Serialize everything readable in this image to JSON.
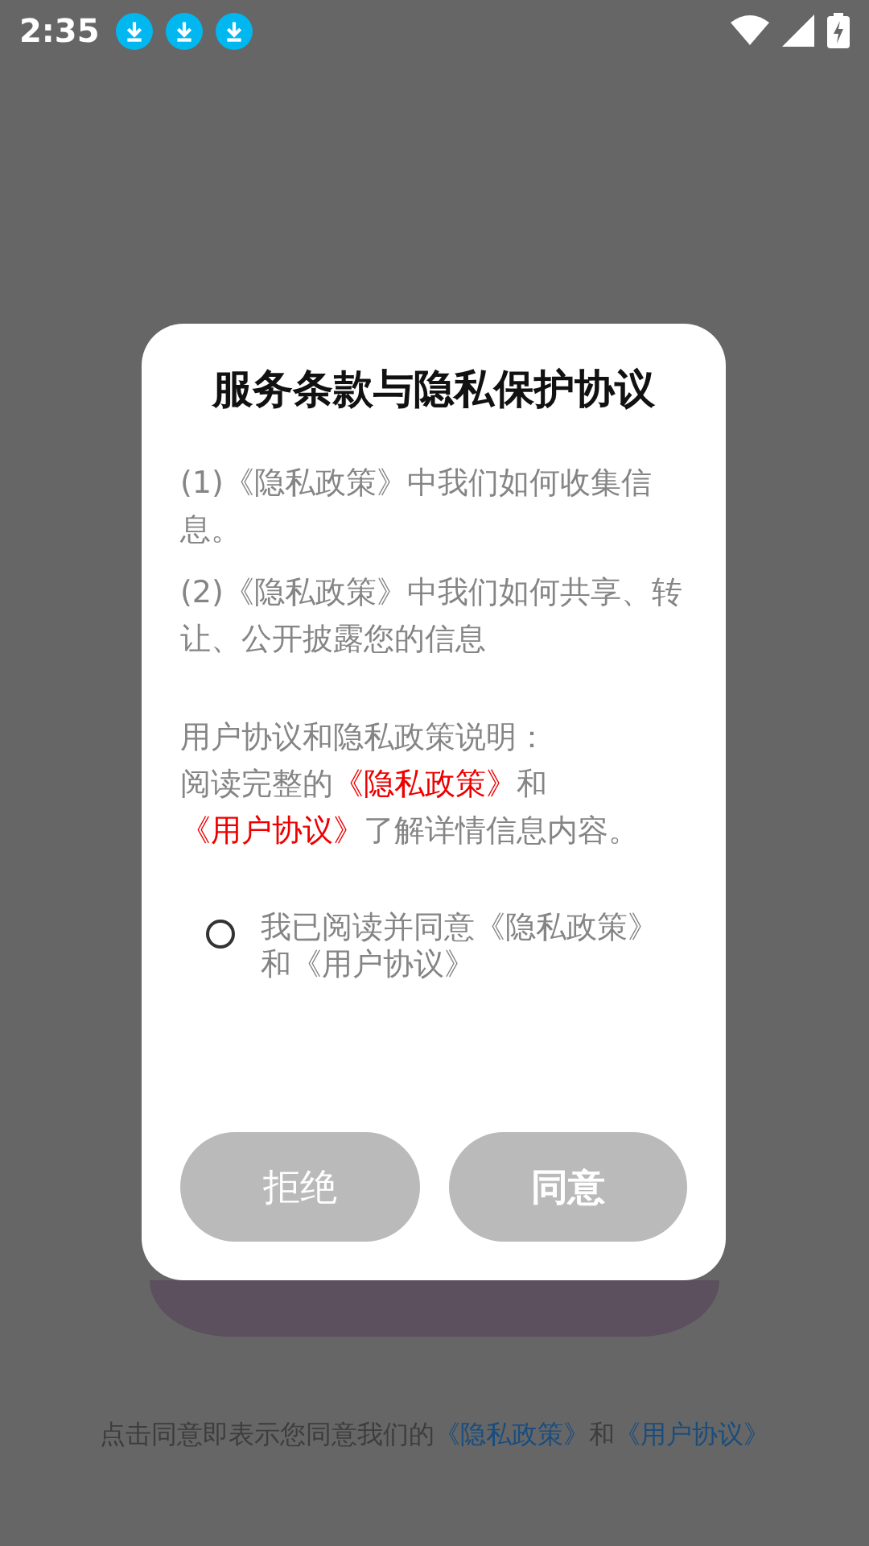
{
  "status_bar": {
    "time": "2:35"
  },
  "background": {
    "footer": [
      {
        "kind": "plain",
        "text": "点击同意即表示您同意我们的"
      },
      {
        "kind": "link",
        "text": "《隐私政策》"
      },
      {
        "kind": "plain",
        "text": "和"
      },
      {
        "kind": "link",
        "text": "《用户协议》"
      }
    ]
  },
  "dialog": {
    "title": "服务条款与隐私保护协议",
    "items": [
      "(1)《隐私政策》中我们如何收集信息。",
      "(2)《隐私政策》中我们如何共享、转让、公开披露您的信息"
    ],
    "note_heading": "用户协议和隐私政策说明：",
    "note": [
      {
        "kind": "plain",
        "text": "阅读完整的"
      },
      {
        "kind": "link",
        "text": "《隐私政策》"
      },
      {
        "kind": "plain",
        "text": "和"
      },
      {
        "kind": "link",
        "text": "《用户协议》"
      },
      {
        "kind": "plain",
        "text": "了解详情信息内容。"
      }
    ],
    "consent": {
      "label": "我已阅读并同意《隐私政策》和《用户协议》",
      "checked": false
    },
    "buttons": [
      {
        "label": "拒绝",
        "kind": "decline"
      },
      {
        "label": "同意",
        "kind": "accept"
      }
    ]
  }
}
